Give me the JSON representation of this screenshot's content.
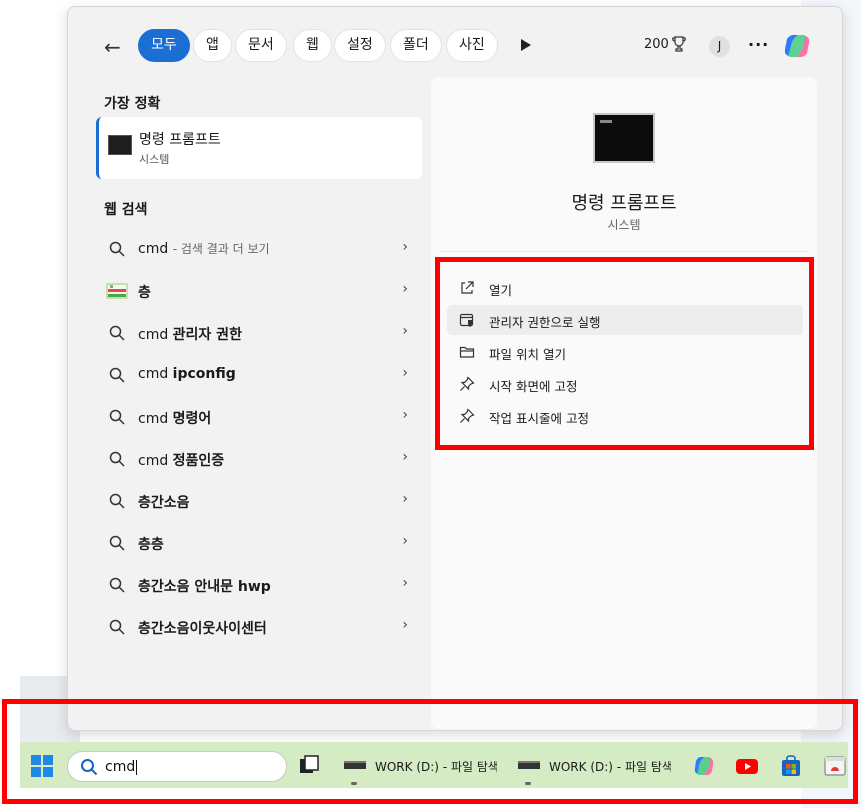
{
  "filters": {
    "back": "←",
    "tabs": [
      "모두",
      "앱",
      "문서",
      "웹",
      "설정",
      "폴더",
      "사진"
    ],
    "points": "200",
    "avatar": "J",
    "more": "···"
  },
  "best_match": {
    "heading": "가장 정확",
    "name": "명령 프롬프트",
    "type": "시스템"
  },
  "web_search": {
    "heading": "웹 검색",
    "first_query": "cmd",
    "first_hint": "- 검색 결과 더 보기",
    "second_query": "층",
    "items": [
      {
        "prefix": "cmd ",
        "bold": "관리자 권한"
      },
      {
        "prefix": "cmd ",
        "bold": "ipconfig"
      },
      {
        "prefix": "cmd ",
        "bold": "명령어"
      },
      {
        "prefix": "cmd ",
        "bold": "정품인증"
      },
      {
        "prefix": "",
        "bold": "층간소음"
      },
      {
        "prefix": "",
        "bold": "층층"
      },
      {
        "prefix": "",
        "bold": "층간소음 안내문 hwp"
      },
      {
        "prefix": "",
        "bold": "층간소음이웃사이센터"
      }
    ]
  },
  "detail": {
    "title": "명령 프롬프트",
    "subtitle": "시스템",
    "actions": [
      "열기",
      "관리자 권한으로 실행",
      "파일 위치 열기",
      "시작 화면에 고정",
      "작업 표시줄에 고정"
    ]
  },
  "taskbar": {
    "search_value": "cmd",
    "app1": "WORK (D:) - 파일 탐색기",
    "app2": "WORK (D:) - 파일 탐색기"
  },
  "colors": {
    "accent": "#1b6ed4",
    "highlight": "#ff0000",
    "taskbar": "#d4ebc4"
  }
}
